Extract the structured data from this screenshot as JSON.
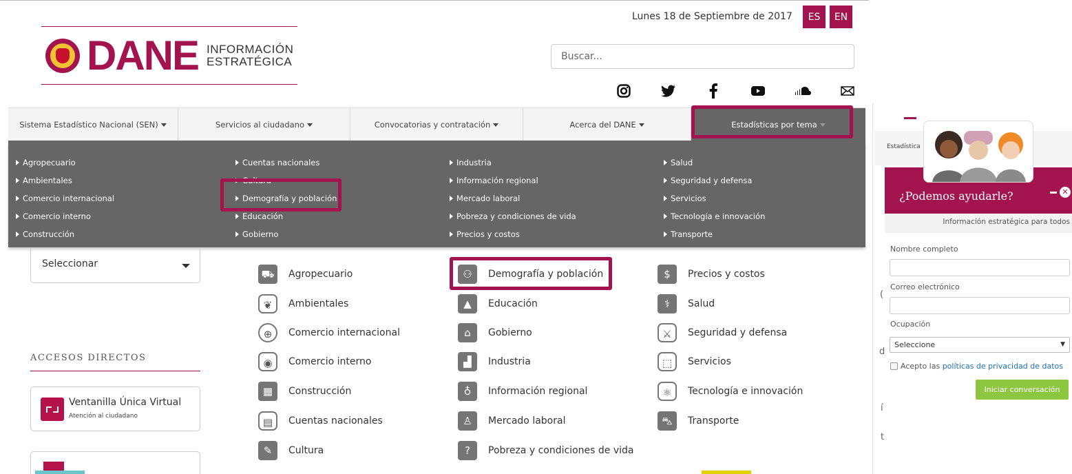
{
  "header": {
    "date": "Lunes 18 de Septiembre de 2017",
    "lang_es": "ES",
    "lang_en": "EN",
    "logo_text": "DANE",
    "logo_sub1": "INFORMACIÓN",
    "logo_sub2": "ESTRATÉGICA",
    "search_placeholder": "Buscar...",
    "social": [
      "instagram-icon",
      "twitter-icon",
      "facebook-icon",
      "youtube-icon",
      "soundcloud-icon",
      "mail-icon"
    ]
  },
  "nav": {
    "items": [
      {
        "label": "Sistema Estadístico Nacional (SEN)"
      },
      {
        "label": "Servicios al ciudadano"
      },
      {
        "label": "Convocatorias y contratación"
      },
      {
        "label": "Acerca del DANE"
      },
      {
        "label": "Estadísticas por tema"
      }
    ]
  },
  "mega": {
    "col1": [
      "Agropecuario",
      "Ambientales",
      "Comercio internacional",
      "Comercio interno",
      "Construcción"
    ],
    "col2": [
      "Cuentas nacionales",
      "Cultura",
      "Demografía y población",
      "Educación",
      "Gobierno"
    ],
    "col3": [
      "Industria",
      "Información regional",
      "Mercado laboral",
      "Pobreza y condiciones de vida",
      "Precios y costos"
    ],
    "col4": [
      "Salud",
      "Seguridad y defensa",
      "Servicios",
      "Tecnología e innovación",
      "Transporte"
    ]
  },
  "left": {
    "select_value": "Seleccionar",
    "accesos_title": "ACCESOS DIRECTOS",
    "vu_title": "Ventanilla Única Virtual",
    "vu_sub": "Atención al ciudadano"
  },
  "topics": {
    "col1": [
      "Agropecuario",
      "Ambientales",
      "Comercio internacional",
      "Comercio interno",
      "Construcción",
      "Cuentas nacionales",
      "Cultura"
    ],
    "col2": [
      "Demografía y población",
      "Educación",
      "Gobierno",
      "Industria",
      "Información regional",
      "Mercado laboral",
      "Pobreza y condiciones de vida"
    ],
    "col3": [
      "Precios y costos",
      "Salud",
      "Seguridad y defensa",
      "Servicios",
      "Tecnología e innovación",
      "Transporte"
    ]
  },
  "chat": {
    "tab_label": "Estadística",
    "title": "¿Podemos ayudarle?",
    "subtitle": "Información estratégica para todos",
    "name_label": "Nombre completo",
    "email_label": "Correo electrónico",
    "occupation_label": "Ocupación",
    "occupation_value": "Seleccione",
    "accept_text": "Acepto las ",
    "accept_link": "políticas de privacidad de datos",
    "start_button": "Iniciar conversación"
  },
  "colors": {
    "brand": "#a3144e",
    "menu_bg": "#666666",
    "button_green": "#8dc63f"
  }
}
